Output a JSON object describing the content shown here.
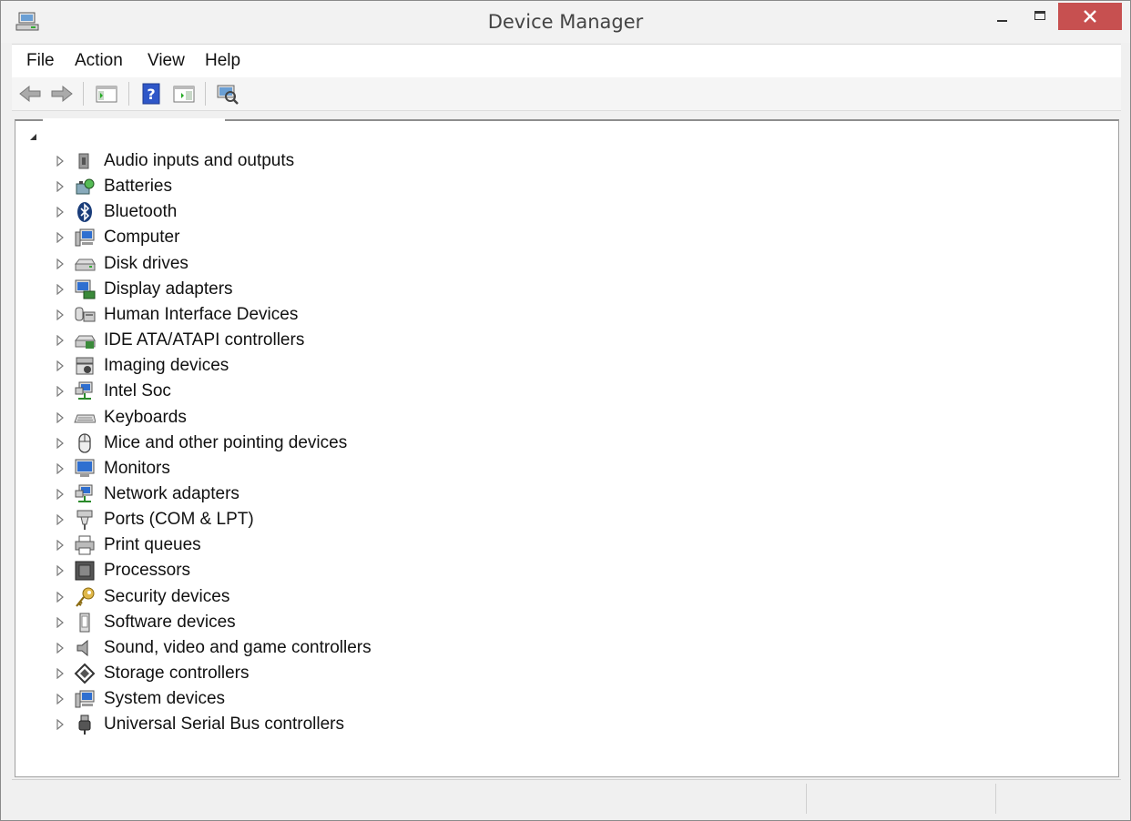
{
  "window": {
    "title": "Device Manager"
  },
  "menu": {
    "items": [
      "File",
      "Action",
      "View",
      "Help"
    ]
  },
  "toolbar": {
    "buttons": [
      "back-arrow-icon",
      "forward-arrow-icon",
      "show-hide-console-tree-icon",
      "help-icon",
      "properties-pane-icon",
      "scan-hardware-icon"
    ]
  },
  "tree": {
    "categories": [
      {
        "label": "Audio inputs and outputs",
        "icon": "audio-icon"
      },
      {
        "label": "Batteries",
        "icon": "battery-icon"
      },
      {
        "label": "Bluetooth",
        "icon": "bluetooth-icon"
      },
      {
        "label": "Computer",
        "icon": "computer-icon"
      },
      {
        "label": "Disk drives",
        "icon": "disk-drive-icon"
      },
      {
        "label": "Display adapters",
        "icon": "display-adapter-icon"
      },
      {
        "label": "Human Interface Devices",
        "icon": "hid-icon"
      },
      {
        "label": "IDE ATA/ATAPI controllers",
        "icon": "ide-controller-icon"
      },
      {
        "label": "Imaging devices",
        "icon": "camera-icon"
      },
      {
        "label": "Intel Soc",
        "icon": "network-icon"
      },
      {
        "label": "Keyboards",
        "icon": "keyboard-icon"
      },
      {
        "label": "Mice and other pointing devices",
        "icon": "mouse-icon"
      },
      {
        "label": "Monitors",
        "icon": "monitor-icon"
      },
      {
        "label": "Network adapters",
        "icon": "network-icon"
      },
      {
        "label": "Ports (COM & LPT)",
        "icon": "port-icon"
      },
      {
        "label": "Print queues",
        "icon": "printer-icon"
      },
      {
        "label": "Processors",
        "icon": "processor-icon"
      },
      {
        "label": "Security devices",
        "icon": "key-icon"
      },
      {
        "label": "Software devices",
        "icon": "software-device-icon"
      },
      {
        "label": "Sound, video and game controllers",
        "icon": "speaker-icon"
      },
      {
        "label": "Storage controllers",
        "icon": "storage-controller-icon"
      },
      {
        "label": "System devices",
        "icon": "computer-icon"
      },
      {
        "label": "Universal Serial Bus controllers",
        "icon": "usb-icon"
      }
    ]
  },
  "colors": {
    "close_button": "#c75050",
    "window_bg": "#f0f0f0",
    "tree_bg": "#ffffff"
  }
}
